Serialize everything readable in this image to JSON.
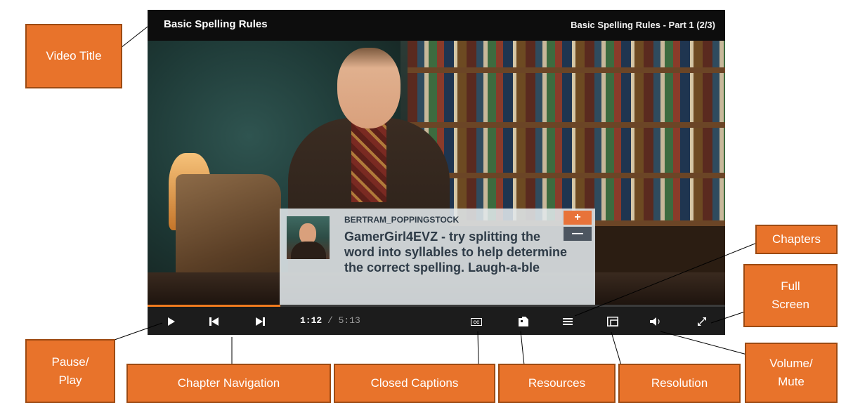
{
  "player": {
    "video_title": "Basic Spelling Rules",
    "part_title": "Basic Spelling Rules - Part 1  (2/3)",
    "comment": {
      "username": "BERTRAM_POPPINGSTOCK",
      "text": "GamerGirl4EVZ - try splitting the word into syllables to help determine the correct spelling. Laugh-a-ble",
      "plus_label": "+",
      "minus_label": "—"
    },
    "progress": 0.23,
    "time": {
      "current": "1:12",
      "separator": " / ",
      "duration": "5:13"
    },
    "controls": {
      "cc_label": "CC"
    }
  },
  "callouts": {
    "video_title": "Video Title",
    "chapters": "Chapters",
    "full_screen": "Full Screen",
    "pause_play": "Pause/ Play",
    "chapter_navigation": "Chapter Navigation",
    "closed_captions": "Closed Captions",
    "resources": "Resources",
    "resolution": "Resolution",
    "volume_mute": "Volume/ Mute"
  },
  "colors": {
    "accent": "#e8732b",
    "accent_border": "#9c4a12",
    "progress": "#f07b1e",
    "bar_background": "#1c1c1c"
  },
  "icons": [
    "play-icon",
    "previous-chapter-icon",
    "next-chapter-icon",
    "closed-captions-icon",
    "resources-icon",
    "chapters-icon",
    "resolution-icon",
    "volume-icon",
    "fullscreen-icon"
  ]
}
